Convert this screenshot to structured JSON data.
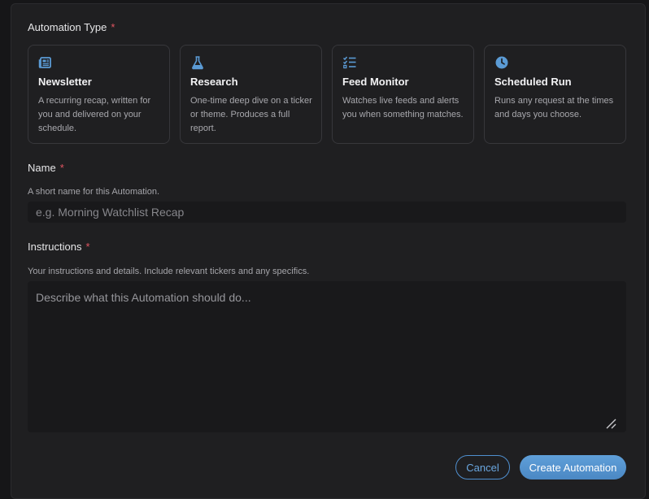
{
  "automation_type": {
    "label": "Automation Type",
    "required_mark": "*",
    "cards": [
      {
        "icon": "newspaper-icon",
        "title": "Newsletter",
        "description": "A recurring recap, written for you and delivered on your schedule."
      },
      {
        "icon": "flask-icon",
        "title": "Research",
        "description": "One-time deep dive on a ticker or theme. Produces a full report."
      },
      {
        "icon": "checklist-icon",
        "title": "Feed Monitor",
        "description": "Watches live feeds and alerts you when something matches."
      },
      {
        "icon": "clock-icon",
        "title": "Scheduled Run",
        "description": "Runs any request at the times and days you choose."
      }
    ]
  },
  "name_field": {
    "label": "Name",
    "required_mark": "*",
    "hint": "A short name for this Automation.",
    "placeholder": "e.g. Morning Watchlist Recap",
    "value": ""
  },
  "instructions_field": {
    "label": "Instructions",
    "required_mark": "*",
    "hint": "Your instructions and details. Include relevant tickers and any specifics.",
    "placeholder": "Describe what this Automation should do...",
    "value": ""
  },
  "actions": {
    "cancel_label": "Cancel",
    "create_label": "Create Automation"
  },
  "colors": {
    "accent": "#4f8fcf",
    "required": "#e05561",
    "panel_bg": "#1f1f21",
    "input_bg": "#19191b"
  }
}
